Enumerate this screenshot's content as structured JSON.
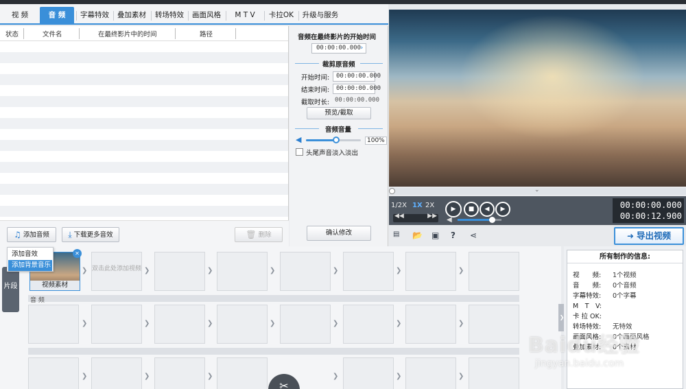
{
  "tabs": [
    {
      "label": "视 频",
      "active": false
    },
    {
      "label": "音 频",
      "active": true
    },
    {
      "label": "字幕特效",
      "active": false
    },
    {
      "label": "叠加素材",
      "active": false
    },
    {
      "label": "转场特效",
      "active": false
    },
    {
      "label": "画面风格",
      "active": false
    },
    {
      "label": "M T V",
      "active": false
    },
    {
      "label": "卡拉OK",
      "active": false
    },
    {
      "label": "升级与服务",
      "active": false
    }
  ],
  "file_list": {
    "columns": [
      "状态",
      "文件名",
      "在最终影片中的时间",
      "路径"
    ]
  },
  "list_buttons": {
    "add_audio": "添加音频",
    "download_more": "下载更多音效",
    "delete": "删除"
  },
  "add_menu": [
    "添加音效",
    "添加背景音乐"
  ],
  "audio_panel": {
    "start_time_title": "音频在最终影片的开始时间",
    "start_time_value": "00:00:00.000",
    "crop_section": "裁剪原音频",
    "start_label": "开始时间:",
    "start_value": "00:00:00.000",
    "end_label": "结束时间:",
    "end_value": "00:00:00.000",
    "duration_label": "截取时长:",
    "duration_value": "00:00:00.000",
    "preview_button": "预览/截取",
    "volume_section": "音频音量",
    "volume_percent": "100%",
    "volume_level": 0.55,
    "fade_label": "头尾声音淡入淡出",
    "fade_checked": false,
    "confirm_button": "确认修改"
  },
  "player": {
    "speeds": [
      "1/2X",
      "1X",
      "2X"
    ],
    "active_speed": "1X",
    "current_time": "00:00:00.000",
    "total_time": "00:00:12.900",
    "volume_level": 0.78,
    "progress": 0.0
  },
  "export_button": "导出视频",
  "timeline": {
    "side_tab": "片段",
    "video_tile_label": "视频素材",
    "empty_tile_hint": "双击此处添加视频",
    "audio_track_label": "音 频"
  },
  "info_panel": {
    "title": "所有制作的信息:",
    "rows": [
      {
        "key": "视　　频:",
        "value": "1个视频"
      },
      {
        "key": "音　　频:",
        "value": "0个音频"
      },
      {
        "key": "字幕特效:",
        "value": "0个字幕"
      },
      {
        "key": "M　T　V:",
        "value": ""
      },
      {
        "key": "卡 拉 OK:",
        "value": ""
      },
      {
        "key": "转场特效:",
        "value": "无特效"
      },
      {
        "key": "画面风格:",
        "value": "0个画面风格"
      },
      {
        "key": "叠加素材:",
        "value": "0个素材"
      }
    ]
  },
  "watermark": {
    "main": "Baidu经验",
    "sub": "jingyan.baidu.com"
  },
  "colors": {
    "accent": "#3a8fd9",
    "panel": "#f2f3f5",
    "control_bar": "#4e5660"
  }
}
